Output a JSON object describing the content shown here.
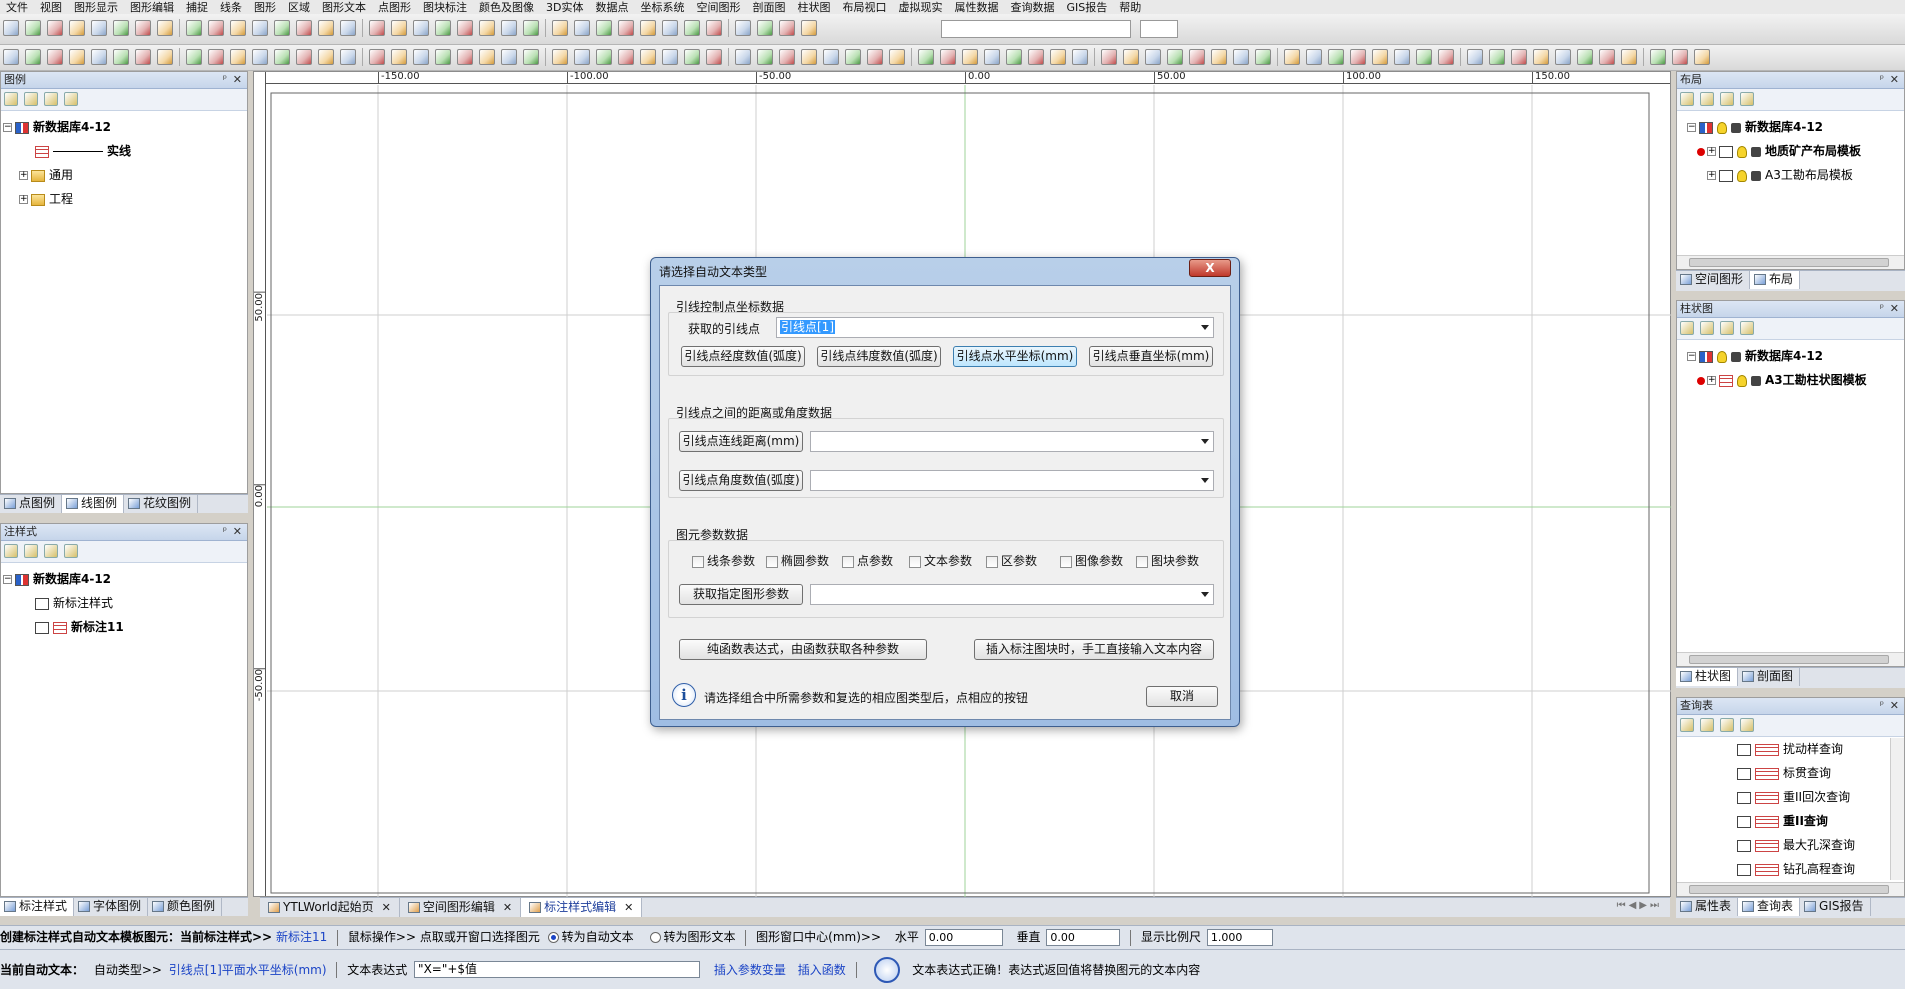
{
  "menu": [
    "文件",
    "视图",
    "图形显示",
    "图形编辑",
    "捕捉",
    "线条",
    "图形",
    "区域",
    "图形文本",
    "点图形",
    "图块标注",
    "颜色及图像",
    "3D实体",
    "数据点",
    "坐标系统",
    "空间图形",
    "剖面图",
    "柱状图",
    "布局视口",
    "虚拟现实",
    "属性数据",
    "查询数据",
    "GIS报告",
    "帮助"
  ],
  "left_top_panel": {
    "title": "图例",
    "tree": [
      {
        "label": "新数据库4-12",
        "bold": true
      },
      {
        "label": "实线",
        "bold": true
      },
      {
        "label": "通用",
        "bold": false
      },
      {
        "label": "工程",
        "bold": false
      }
    ],
    "tabs": [
      "点图例",
      "线图例",
      "花纹图例"
    ]
  },
  "left_bottom_panel": {
    "title": "注样式",
    "tree": [
      {
        "label": "新数据库4-12",
        "bold": true
      },
      {
        "label": "新标注样式",
        "bold": false
      },
      {
        "label": "新标注11",
        "bold": true
      }
    ],
    "tabs": [
      "标注样式",
      "字体图例",
      "颜色图例"
    ]
  },
  "right_top_panel": {
    "title": "布局",
    "tree": [
      {
        "label": "新数据库4-12",
        "bold": true
      },
      {
        "label": "地质矿产布局模板",
        "bold": true
      },
      {
        "label": "A3工勘布局模板",
        "bold": false
      }
    ],
    "tabs": [
      "空间图形",
      "布局"
    ]
  },
  "right_mid_panel": {
    "title": "柱状图",
    "tree": [
      {
        "label": "新数据库4-12",
        "bold": true
      },
      {
        "label": "A3工勘柱状图模板",
        "bold": true
      }
    ],
    "tabs": [
      "柱状图",
      "剖面图"
    ]
  },
  "right_bottom_panel": {
    "title": "查询表",
    "items": [
      {
        "label": "扰动样查询",
        "bold": false
      },
      {
        "label": "标贯查询",
        "bold": false
      },
      {
        "label": "重II回次查询",
        "bold": false
      },
      {
        "label": "重II查询",
        "bold": true
      },
      {
        "label": "最大孔深查询",
        "bold": false
      },
      {
        "label": "钻孔高程查询",
        "bold": false
      }
    ],
    "tabs": [
      "属性表",
      "查询表",
      "GIS报告"
    ]
  },
  "canvas": {
    "ruler_x_labels": [
      "-150.00",
      "-100.00",
      "-50.00",
      "0.00",
      "50.00",
      "100.00",
      "150.00"
    ],
    "ruler_y_labels": [
      "50.00",
      "0.00",
      "-50.00"
    ]
  },
  "doc_tabs": [
    {
      "label": "YTLWorld起始页",
      "active": false
    },
    {
      "label": "空间图形编辑",
      "active": false
    },
    {
      "label": "标注样式编辑",
      "active": true
    }
  ],
  "dialog": {
    "title": "请选择自动文本类型",
    "close_label": "X",
    "group1_label": "引线控制点坐标数据",
    "point_label": "获取的引线点",
    "point_value": "引线点[1]",
    "btn_lon": "引线点经度数值(弧度)",
    "btn_lat": "引线点纬度数值(弧度)",
    "btn_x": "引线点水平坐标(mm)",
    "btn_y": "引线点垂直坐标(mm)",
    "group2_label": "引线点之间的距离或角度数据",
    "btn_dist": "引线点连线距离(mm)",
    "btn_angle": "引线点角度数值(弧度)",
    "group3_label": "图元参数数据",
    "checkboxes": [
      "线条参数",
      "椭圆参数",
      "点参数",
      "文本参数",
      "区参数",
      "图像参数",
      "图块参数"
    ],
    "btn_get_params": "获取指定图形参数",
    "btn_pure": "纯函数表达式，由函数获取各种参数",
    "btn_manual": "插入标注图块时，手工直接输入文本内容",
    "info_text": "请选择组合中所需参数和复选的相应图类型后，点相应的按钮",
    "cancel": "取消"
  },
  "status1": {
    "label": "创建标注样式自动文本模板图元：当前标注样式>>",
    "style_name": "新标注11",
    "mouse_op": "鼠标操作>> 点取或开窗口选择图元",
    "radio1": "转为自动文本",
    "radio2": "转为图形文本",
    "center": "图形窗口中心(mm)>>",
    "h_label": "水平",
    "h_value": "0.00",
    "v_label": "垂直",
    "v_value": "0.00",
    "scale_label": "显示比例尺",
    "scale_value": "1.000"
  },
  "status2": {
    "label": "当前自动文本：",
    "type_label": "自动类型>>",
    "type_value": "引线点[1]平面水平坐标(mm)",
    "expr_label": "文本表达式",
    "expr_value": "\"X=\"+$值",
    "insert_var": "插入参数变量",
    "insert_func": "插入函数",
    "message": "文本表达式正确！表达式返回值将替换图元的文本内容"
  }
}
